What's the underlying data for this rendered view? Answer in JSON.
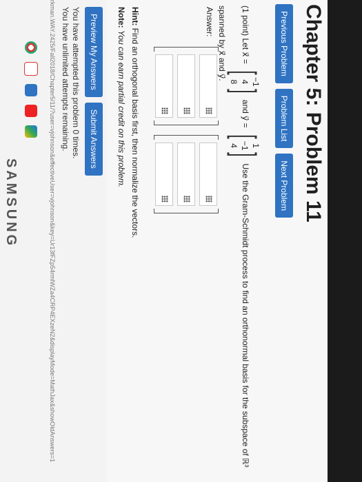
{
  "page": {
    "title": "Chapter 5: Problem 11",
    "nav_buttons": [
      "Previous Problem",
      "Problem List",
      "Next Problem"
    ]
  },
  "question": {
    "prefix": "(1 point) Let",
    "x_label": "x⃗ =",
    "x_vector": [
      "−1",
      "4",
      "8"
    ],
    "and_label": "and y⃗ =",
    "y_vector": [
      "1",
      "−1",
      "4"
    ],
    "text": "Use the Gram-Schmidt process to find an orthonormal basis for the subspace of ℝ³ spanned by x⃗ and y⃗."
  },
  "answer": {
    "label": "Answer:",
    "vector_count": 2,
    "entries_per_vector": 3
  },
  "hint": {
    "label": "Hint:",
    "text": "Find an orthogonal basis first, then normalize the vectors."
  },
  "note": {
    "label": "Note:",
    "text": "You can earn partial credit on this problem."
  },
  "actions": {
    "preview": "Preview My Answers",
    "submit": "Submit Answers"
  },
  "status": {
    "line1": "You have attempted this problem 0 times.",
    "line2": "You have unlimited attempts remaining."
  },
  "url_text": "rkman.WAY.2425/Fall2018/Chapter5/11/?user=vjohnson&effectiveUser=vjohnson&key=Ur13fFZp54rmlWZa4CRP4EXzeN2&displayMode=MathJax&showOldAnswers=1",
  "brand": "SAMSUNG",
  "colors": {
    "button": "#2f73c2"
  }
}
